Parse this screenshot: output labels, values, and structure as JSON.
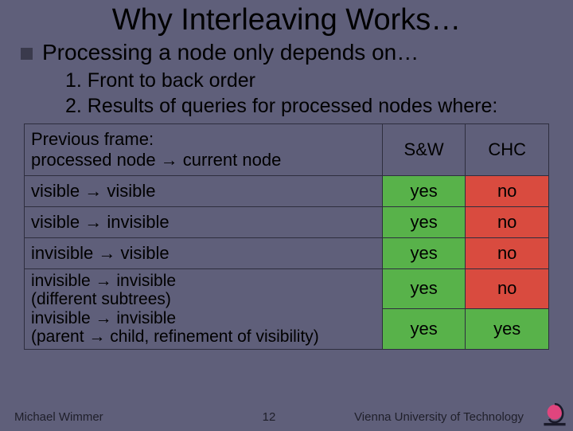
{
  "title": "Why Interleaving Works…",
  "bullet": "Processing a node only depends on…",
  "list": {
    "i1": "1.  Front to back order",
    "i2": "2.  Results of queries for processed nodes where:"
  },
  "table": {
    "h0": "Previous frame:\nprocessed node → current node",
    "h1": "S&W",
    "h2": "CHC",
    "r1c0": "visible → visible",
    "r2c0": "visible → invisible",
    "r3c0": "invisible → visible",
    "r4c0a": "invisible → invisible",
    "r4c0b": "(different subtrees)",
    "r5c0a": "invisible → invisible",
    "r5c0b": "(parent → child, refinement of visibility)",
    "yes": "yes",
    "no": "no"
  },
  "footer": {
    "left": "Michael Wimmer",
    "mid": "12",
    "right": "Vienna University of Technology"
  }
}
